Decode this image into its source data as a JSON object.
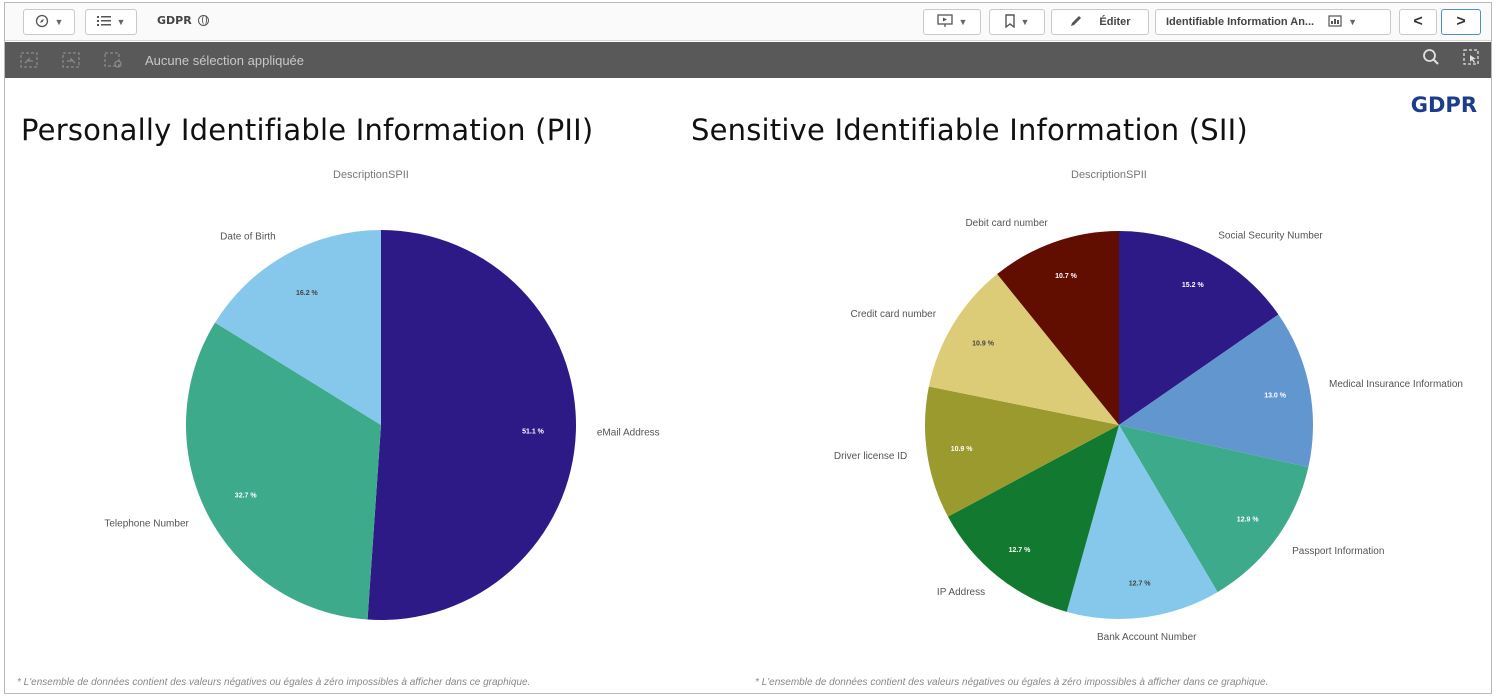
{
  "toolbar": {
    "app_name": "GDPR",
    "edit_label": "Éditer",
    "sheet_name": "Identifiable Information An...",
    "prev_label": "<",
    "next_label": ">"
  },
  "selection_bar": {
    "status_text": "Aucune sélection appliquée"
  },
  "brand": "GDPR",
  "panels": [
    {
      "title": "Personally Identifiable Information (PII)",
      "footnote": "* L'ensemble de données contient des valeurs négatives ou égales à zéro impossibles à afficher dans ce graphique."
    },
    {
      "title": "Sensitive Identifiable Information (SII)",
      "footnote": "* L'ensemble de données contient des valeurs négatives ou égales à zéro impossibles à afficher dans ce graphique."
    }
  ],
  "chart_data": [
    {
      "type": "pie",
      "title": "DescriptionSPII",
      "slices": [
        {
          "label": "eMail Address",
          "value": 51.1,
          "value_label": "51.1 %",
          "color": "#2e1a87"
        },
        {
          "label": "Telephone Number",
          "value": 32.7,
          "value_label": "32.7 %",
          "color": "#3eaa8c"
        },
        {
          "label": "Date of Birth",
          "value": 16.2,
          "value_label": "16.2 %",
          "color": "#85c8ec"
        }
      ]
    },
    {
      "type": "pie",
      "title": "DescriptionSPII",
      "slices": [
        {
          "label": "Social Security Number",
          "value": 15.2,
          "value_label": "15.2 %",
          "color": "#2e1a87"
        },
        {
          "label": "Medical Insurance Information",
          "value": 13.0,
          "value_label": "13.0 %",
          "color": "#6196cf"
        },
        {
          "label": "Passport Information",
          "value": 12.9,
          "value_label": "12.9 %",
          "color": "#3eaa8c"
        },
        {
          "label": "Bank Account Number",
          "value": 12.7,
          "value_label": "12.7 %",
          "color": "#85c8ec"
        },
        {
          "label": "IP Address",
          "value": 12.7,
          "value_label": "12.7 %",
          "color": "#117a30"
        },
        {
          "label": "Driver license ID",
          "value": 10.9,
          "value_label": "10.9 %",
          "color": "#9a9a2e"
        },
        {
          "label": "Credit card number",
          "value": 10.9,
          "value_label": "10.9 %",
          "color": "#dccc78"
        },
        {
          "label": "Debit card number",
          "value": 10.7,
          "value_label": "10.7 %",
          "color": "#610e00"
        }
      ]
    }
  ]
}
